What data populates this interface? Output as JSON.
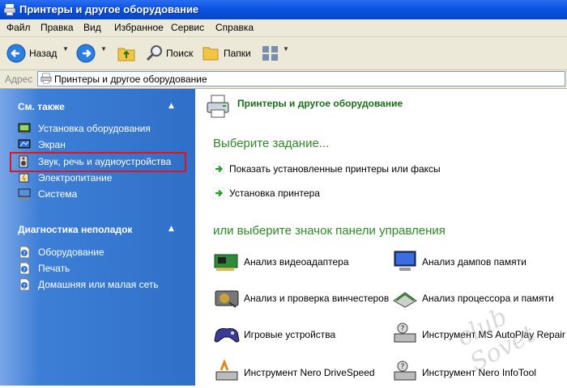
{
  "window": {
    "title": "Принтеры и другое оборудование"
  },
  "menu": [
    "Файл",
    "Правка",
    "Вид",
    "Избранное",
    "Сервис",
    "Справка"
  ],
  "toolbar": {
    "back": "Назад",
    "search": "Поиск",
    "folders": "Папки"
  },
  "address": {
    "label": "Адрес",
    "value": "Принтеры и другое оборудование"
  },
  "sidebar": {
    "see_also": {
      "title": "См. также",
      "items": [
        "Установка оборудования",
        "Экран",
        "Звук, речь и аудиоустройства",
        "Электропитание",
        "Система"
      ]
    },
    "troubleshoot": {
      "title": "Диагностика неполадок",
      "items": [
        "Оборудование",
        "Печать",
        "Домашняя или малая сеть"
      ]
    }
  },
  "main": {
    "category_title": "Принтеры и другое оборудование",
    "pick_task": "Выберите задание...",
    "tasks": [
      "Показать установленные принтеры или факсы",
      "Установка принтера"
    ],
    "pick_icon": "или выберите значок панели управления",
    "icons": [
      "Анализ видеоадаптера",
      "Анализ дампов памяти",
      "Анализ и проверка винчестеров",
      "Анализ процессора и памяти",
      "Игровые устройства",
      "Инструмент MS AutoPlay Repair",
      "Инструмент Nero DriveSpeed",
      "Инструмент Nero InfoTool"
    ]
  },
  "watermark": "club Sovet"
}
